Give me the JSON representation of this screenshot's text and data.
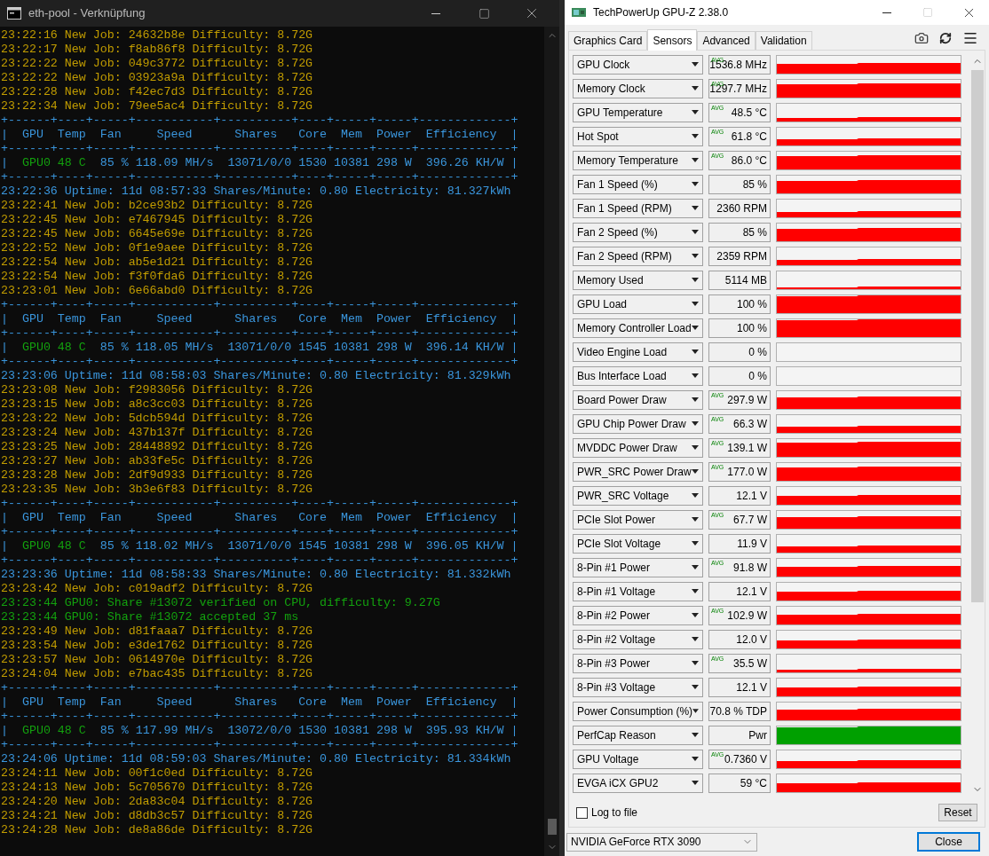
{
  "terminal": {
    "title": "eth-pool - Verknüpfung",
    "lines": [
      {
        "kind": "job",
        "text": "23:22:16 New Job: 24632b8e Difficulty: 8.72G"
      },
      {
        "kind": "job",
        "text": "23:22:17 New Job: f8ab86f8 Difficulty: 8.72G"
      },
      {
        "kind": "job",
        "text": "23:22:22 New Job: 049c3772 Difficulty: 8.72G"
      },
      {
        "kind": "job",
        "text": "23:22:22 New Job: 03923a9a Difficulty: 8.72G"
      },
      {
        "kind": "job",
        "text": "23:22:28 New Job: f42ec7d3 Difficulty: 8.72G"
      },
      {
        "kind": "job",
        "text": "23:22:34 New Job: 79ee5ac4 Difficulty: 8.72G"
      },
      {
        "kind": "table",
        "text": "+------+----+-----+-----------+----------+----+-----+-----+-------------+"
      },
      {
        "kind": "table",
        "text": "|  GPU  Temp  Fan     Speed      Shares   Core  Mem  Power  Efficiency  |"
      },
      {
        "kind": "table",
        "text": "+------+----+-----+-----------+----------+----+-----+-----+-------------+"
      },
      {
        "kind": "gpu",
        "lead": "|",
        "gpu": "GPU0 48 C",
        "rest": "85 % 118.09 MH/s  13071/0/0 1530 10381 298 W  396.26 KH/W |"
      },
      {
        "kind": "table",
        "text": "+------+----+-----+-----------+----------+----+-----+-----+-------------+"
      },
      {
        "kind": "info",
        "text": "23:22:36 Uptime: 11d 08:57:33 Shares/Minute: 0.80 Electricity: 81.327kWh"
      },
      {
        "kind": "job",
        "text": "23:22:41 New Job: b2ce93b2 Difficulty: 8.72G"
      },
      {
        "kind": "job",
        "text": "23:22:45 New Job: e7467945 Difficulty: 8.72G"
      },
      {
        "kind": "job",
        "text": "23:22:45 New Job: 6645e69e Difficulty: 8.72G"
      },
      {
        "kind": "job",
        "text": "23:22:52 New Job: 0f1e9aee Difficulty: 8.72G"
      },
      {
        "kind": "job",
        "text": "23:22:54 New Job: ab5e1d21 Difficulty: 8.72G"
      },
      {
        "kind": "job",
        "text": "23:22:54 New Job: f3f0fda6 Difficulty: 8.72G"
      },
      {
        "kind": "job",
        "text": "23:23:01 New Job: 6e66abd0 Difficulty: 8.72G"
      },
      {
        "kind": "table",
        "text": "+------+----+-----+-----------+----------+----+-----+-----+-------------+"
      },
      {
        "kind": "table",
        "text": "|  GPU  Temp  Fan     Speed      Shares   Core  Mem  Power  Efficiency  |"
      },
      {
        "kind": "table",
        "text": "+------+----+-----+-----------+----------+----+-----+-----+-------------+"
      },
      {
        "kind": "gpu",
        "lead": "|",
        "gpu": "GPU0 48 C",
        "rest": "85 % 118.05 MH/s  13071/0/0 1545 10381 298 W  396.14 KH/W |"
      },
      {
        "kind": "table",
        "text": "+------+----+-----+-----------+----------+----+-----+-----+-------------+"
      },
      {
        "kind": "info",
        "text": "23:23:06 Uptime: 11d 08:58:03 Shares/Minute: 0.80 Electricity: 81.329kWh"
      },
      {
        "kind": "job",
        "text": "23:23:08 New Job: f2983056 Difficulty: 8.72G"
      },
      {
        "kind": "job",
        "text": "23:23:15 New Job: a8c3cc03 Difficulty: 8.72G"
      },
      {
        "kind": "job",
        "text": "23:23:22 New Job: 5dcb594d Difficulty: 8.72G"
      },
      {
        "kind": "job",
        "text": "23:23:24 New Job: 437b137f Difficulty: 8.72G"
      },
      {
        "kind": "job",
        "text": "23:23:25 New Job: 28448892 Difficulty: 8.72G"
      },
      {
        "kind": "job",
        "text": "23:23:27 New Job: ab33fe5c Difficulty: 8.72G"
      },
      {
        "kind": "job",
        "text": "23:23:28 New Job: 2df9d933 Difficulty: 8.72G"
      },
      {
        "kind": "job",
        "text": "23:23:35 New Job: 3b3e6f83 Difficulty: 8.72G"
      },
      {
        "kind": "table",
        "text": "+------+----+-----+-----------+----------+----+-----+-----+-------------+"
      },
      {
        "kind": "table",
        "text": "|  GPU  Temp  Fan     Speed      Shares   Core  Mem  Power  Efficiency  |"
      },
      {
        "kind": "table",
        "text": "+------+----+-----+-----------+----------+----+-----+-----+-------------+"
      },
      {
        "kind": "gpu",
        "lead": "|",
        "gpu": "GPU0 48 C",
        "rest": "85 % 118.02 MH/s  13071/0/0 1545 10381 298 W  396.05 KH/W |"
      },
      {
        "kind": "table",
        "text": "+------+----+-----+-----------+----------+----+-----+-----+-------------+"
      },
      {
        "kind": "info",
        "text": "23:23:36 Uptime: 11d 08:58:33 Shares/Minute: 0.80 Electricity: 81.332kWh"
      },
      {
        "kind": "job",
        "text": "23:23:42 New Job: c019adf2 Difficulty: 8.72G"
      },
      {
        "kind": "share",
        "text": "23:23:44 GPU0: Share #13072 verified on CPU, difficulty: 9.27G"
      },
      {
        "kind": "share",
        "text": "23:23:44 GPU0: Share #13072 accepted 37 ms"
      },
      {
        "kind": "job",
        "text": "23:23:49 New Job: d81faaa7 Difficulty: 8.72G"
      },
      {
        "kind": "job",
        "text": "23:23:54 New Job: e3de1762 Difficulty: 8.72G"
      },
      {
        "kind": "job",
        "text": "23:23:57 New Job: 0614970e Difficulty: 8.72G"
      },
      {
        "kind": "job",
        "text": "23:24:04 New Job: e7bac435 Difficulty: 8.72G"
      },
      {
        "kind": "table",
        "text": "+------+----+-----+-----------+----------+----+-----+-----+-------------+"
      },
      {
        "kind": "table",
        "text": "|  GPU  Temp  Fan     Speed      Shares   Core  Mem  Power  Efficiency  |"
      },
      {
        "kind": "table",
        "text": "+------+----+-----+-----------+----------+----+-----+-----+-------------+"
      },
      {
        "kind": "gpu",
        "lead": "|",
        "gpu": "GPU0 48 C",
        "rest": "85 % 117.99 MH/s  13072/0/0 1530 10381 298 W  395.93 KH/W |"
      },
      {
        "kind": "table",
        "text": "+------+----+-----+-----------+----------+----+-----+-----+-------------+"
      },
      {
        "kind": "info",
        "text": "23:24:06 Uptime: 11d 08:59:03 Shares/Minute: 0.80 Electricity: 81.334kWh"
      },
      {
        "kind": "job",
        "text": "23:24:11 New Job: 00f1c0ed Difficulty: 8.72G"
      },
      {
        "kind": "job",
        "text": "23:24:13 New Job: 5c705670 Difficulty: 8.72G"
      },
      {
        "kind": "job",
        "text": "23:24:20 New Job: 2da83c04 Difficulty: 8.72G"
      },
      {
        "kind": "job",
        "text": "23:24:21 New Job: d8db3c57 Difficulty: 8.72G"
      },
      {
        "kind": "job",
        "text": "23:24:28 New Job: de8a86de Difficulty: 8.72G"
      }
    ]
  },
  "gpuz": {
    "title": "TechPowerUp GPU-Z 2.38.0",
    "tabs": [
      {
        "label": "Graphics Card",
        "selected": false
      },
      {
        "label": "Sensors",
        "selected": true
      },
      {
        "label": "Advanced",
        "selected": false
      },
      {
        "label": "Validation",
        "selected": false
      }
    ],
    "sensors": [
      {
        "name": "GPU Clock",
        "badge": "AVG",
        "value": "1536.8 MHz",
        "color": "#ff0000"
      },
      {
        "name": "Memory Clock",
        "badge": "AVG",
        "value": "1297.7 MHz",
        "color": "#ff0000"
      },
      {
        "name": "GPU Temperature",
        "badge": "AVG",
        "value": "48.5 °C",
        "color": "#ff0000"
      },
      {
        "name": "Hot Spot",
        "badge": "AVG",
        "value": "61.8 °C",
        "color": "#ff0000"
      },
      {
        "name": "Memory Temperature",
        "badge": "AVG",
        "value": "86.0 °C",
        "color": "#ff0000"
      },
      {
        "name": "Fan 1 Speed (%)",
        "value": "85 %",
        "color": "#ff0000"
      },
      {
        "name": "Fan 1 Speed (RPM)",
        "value": "2360 RPM",
        "color": "#ff0000"
      },
      {
        "name": "Fan 2 Speed (%)",
        "value": "85 %",
        "color": "#ff0000"
      },
      {
        "name": "Fan 2 Speed (RPM)",
        "value": "2359 RPM",
        "color": "#ff0000"
      },
      {
        "name": "Memory Used",
        "value": "5114 MB",
        "color": "#ff0000"
      },
      {
        "name": "GPU Load",
        "value": "100 %",
        "color": "#ff0000"
      },
      {
        "name": "Memory Controller Load",
        "value": "100 %",
        "color": "#ff0000"
      },
      {
        "name": "Video Engine Load",
        "value": "0 %"
      },
      {
        "name": "Bus Interface Load",
        "value": "0 %"
      },
      {
        "name": "Board Power Draw",
        "badge": "AVG",
        "value": "297.9 W",
        "color": "#ff0000"
      },
      {
        "name": "GPU Chip Power Draw",
        "badge": "AVG",
        "value": "66.3 W",
        "color": "#ff0000"
      },
      {
        "name": "MVDDC Power Draw",
        "badge": "AVG",
        "value": "139.1 W",
        "color": "#ff0000"
      },
      {
        "name": "PWR_SRC Power Draw",
        "badge": "AVG",
        "value": "177.0 W",
        "color": "#ff0000"
      },
      {
        "name": "PWR_SRC Voltage",
        "value": "12.1 V",
        "color": "#ff0000"
      },
      {
        "name": "PCIe Slot Power",
        "badge": "AVG",
        "value": "67.7 W",
        "color": "#ff0000"
      },
      {
        "name": "PCIe Slot Voltage",
        "value": "11.9 V",
        "color": "#ff0000"
      },
      {
        "name": "8-Pin #1 Power",
        "badge": "AVG",
        "value": "91.8 W",
        "color": "#ff0000"
      },
      {
        "name": "8-Pin #1 Voltage",
        "value": "12.1 V",
        "color": "#ff0000"
      },
      {
        "name": "8-Pin #2 Power",
        "badge": "AVG",
        "value": "102.9 W",
        "color": "#ff0000"
      },
      {
        "name": "8-Pin #2 Voltage",
        "value": "12.0 V",
        "color": "#ff0000"
      },
      {
        "name": "8-Pin #3 Power",
        "badge": "AVG",
        "value": "35.5 W",
        "color": "#ff0000"
      },
      {
        "name": "8-Pin #3 Voltage",
        "value": "12.1 V",
        "color": "#ff0000"
      },
      {
        "name": "Power Consumption (%)",
        "value": "70.8 % TDP",
        "color": "#ff0000"
      },
      {
        "name": "PerfCap Reason",
        "value": "Pwr",
        "color": "#00a000"
      },
      {
        "name": "GPU Voltage",
        "badge": "AVG",
        "value": "0.7360 V",
        "color": "#ff0000"
      },
      {
        "name": "EVGA iCX GPU2",
        "value": "59 °C",
        "color": "#ff0000"
      }
    ],
    "log_to_file": {
      "label": "Log to file",
      "checked": false
    },
    "reset_button": "Reset",
    "device_select": "NVIDIA GeForce RTX 3090",
    "close_button": "Close"
  }
}
